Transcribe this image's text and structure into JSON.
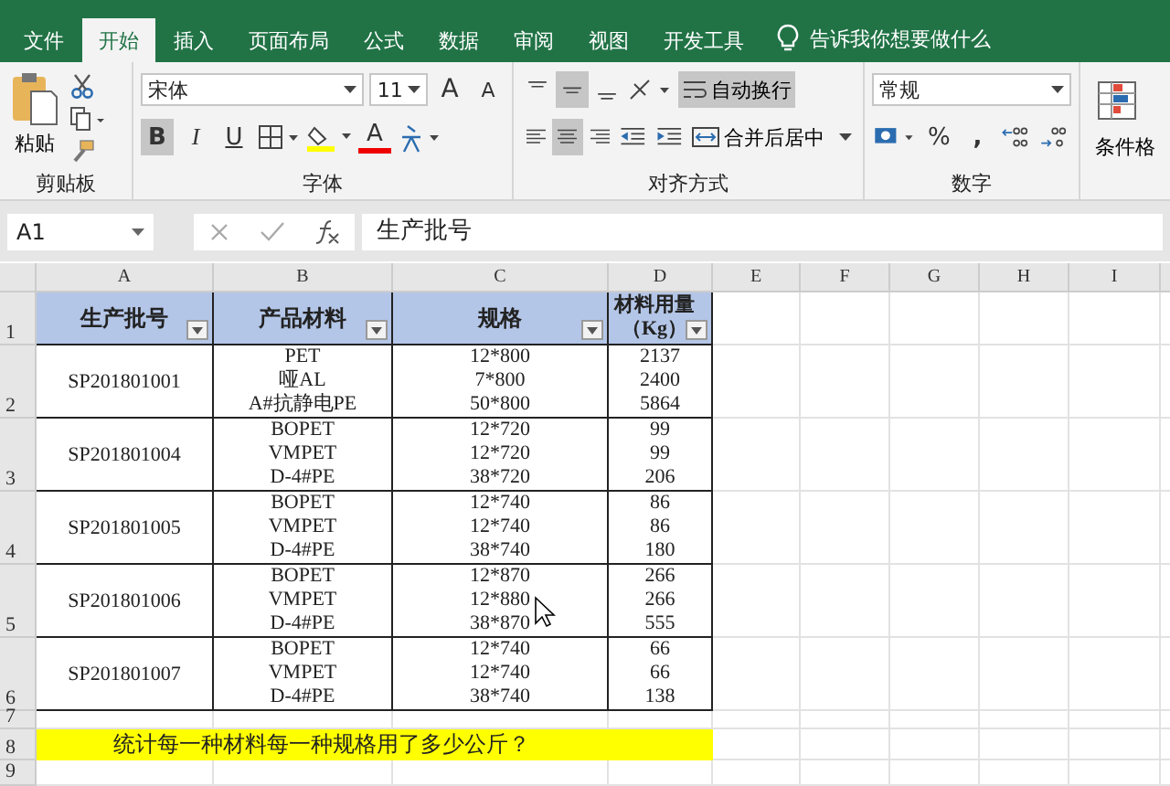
{
  "tabs": [
    {
      "label": "文件",
      "selected": false
    },
    {
      "label": "开始",
      "selected": true
    },
    {
      "label": "插入",
      "selected": false
    },
    {
      "label": "页面布局",
      "selected": false
    },
    {
      "label": "公式",
      "selected": false
    },
    {
      "label": "数据",
      "selected": false
    },
    {
      "label": "审阅",
      "selected": false
    },
    {
      "label": "视图",
      "selected": false
    },
    {
      "label": "开发工具",
      "selected": false
    }
  ],
  "tell_me": "告诉我你想要做什么",
  "clipboard": {
    "paste": "粘贴",
    "group": "剪贴板"
  },
  "font": {
    "name": "宋体",
    "size": "11",
    "grow": "A",
    "shrink": "A",
    "styles": [
      {
        "label": "B",
        "selected": true
      },
      {
        "label": "I",
        "selected": false
      },
      {
        "label": "U",
        "selected": false
      }
    ],
    "color_label": "A",
    "group": "字体"
  },
  "alignment": {
    "vertical": [
      {
        "selected": false
      },
      {
        "selected": true
      },
      {
        "selected": false
      }
    ],
    "horizontal": [
      {
        "selected": false
      },
      {
        "selected": true
      },
      {
        "selected": false
      }
    ],
    "wrap_text": {
      "label": "自动换行",
      "on": true
    },
    "merge": "合并后居中",
    "group": "对齐方式"
  },
  "number": {
    "format": "常规",
    "percent": "%",
    "comma": ",",
    "group": "数字"
  },
  "styles": {
    "conditional": "条件格"
  },
  "formula_bar": {
    "name_box": "A1",
    "formula": "生产批号"
  },
  "sheet": {
    "columns": [
      "A",
      "B",
      "C",
      "D",
      "E",
      "F",
      "G",
      "H",
      "I"
    ],
    "row_numbers": [
      "1",
      "2",
      "3",
      "4",
      "5",
      "6",
      "7",
      "8",
      "9"
    ],
    "headers": [
      "生产批号",
      "产品材料",
      "规格",
      "材料用量（Kg）"
    ],
    "batches": [
      {
        "batch": "SP201801001",
        "items": [
          {
            "material": "PET",
            "spec": "12*800",
            "amount": "2137"
          },
          {
            "material": "哑AL",
            "spec": "7*800",
            "amount": "2400"
          },
          {
            "material": "A#抗静电PE",
            "spec": "50*800",
            "amount": "5864"
          }
        ]
      },
      {
        "batch": "SP201801004",
        "items": [
          {
            "material": "BOPET",
            "spec": "12*720",
            "amount": "99"
          },
          {
            "material": "VMPET",
            "spec": "12*720",
            "amount": "99"
          },
          {
            "material": "D-4#PE",
            "spec": "38*720",
            "amount": "206"
          }
        ]
      },
      {
        "batch": "SP201801005",
        "items": [
          {
            "material": "BOPET",
            "spec": "12*740",
            "amount": "86"
          },
          {
            "material": "VMPET",
            "spec": "12*740",
            "amount": "86"
          },
          {
            "material": "D-4#PE",
            "spec": "38*740",
            "amount": "180"
          }
        ]
      },
      {
        "batch": "SP201801006",
        "items": [
          {
            "material": "BOPET",
            "spec": "12*870",
            "amount": "266"
          },
          {
            "material": "VMPET",
            "spec": "12*880",
            "amount": "266"
          },
          {
            "material": "D-4#PE",
            "spec": "38*870",
            "amount": "555"
          }
        ]
      },
      {
        "batch": "SP201801007",
        "items": [
          {
            "material": "BOPET",
            "spec": "12*740",
            "amount": "66"
          },
          {
            "material": "VMPET",
            "spec": "12*740",
            "amount": "66"
          },
          {
            "material": "D-4#PE",
            "spec": "38*740",
            "amount": "138"
          }
        ]
      }
    ],
    "note": "统计每一种材料每一种规格用了多少公斤？"
  }
}
